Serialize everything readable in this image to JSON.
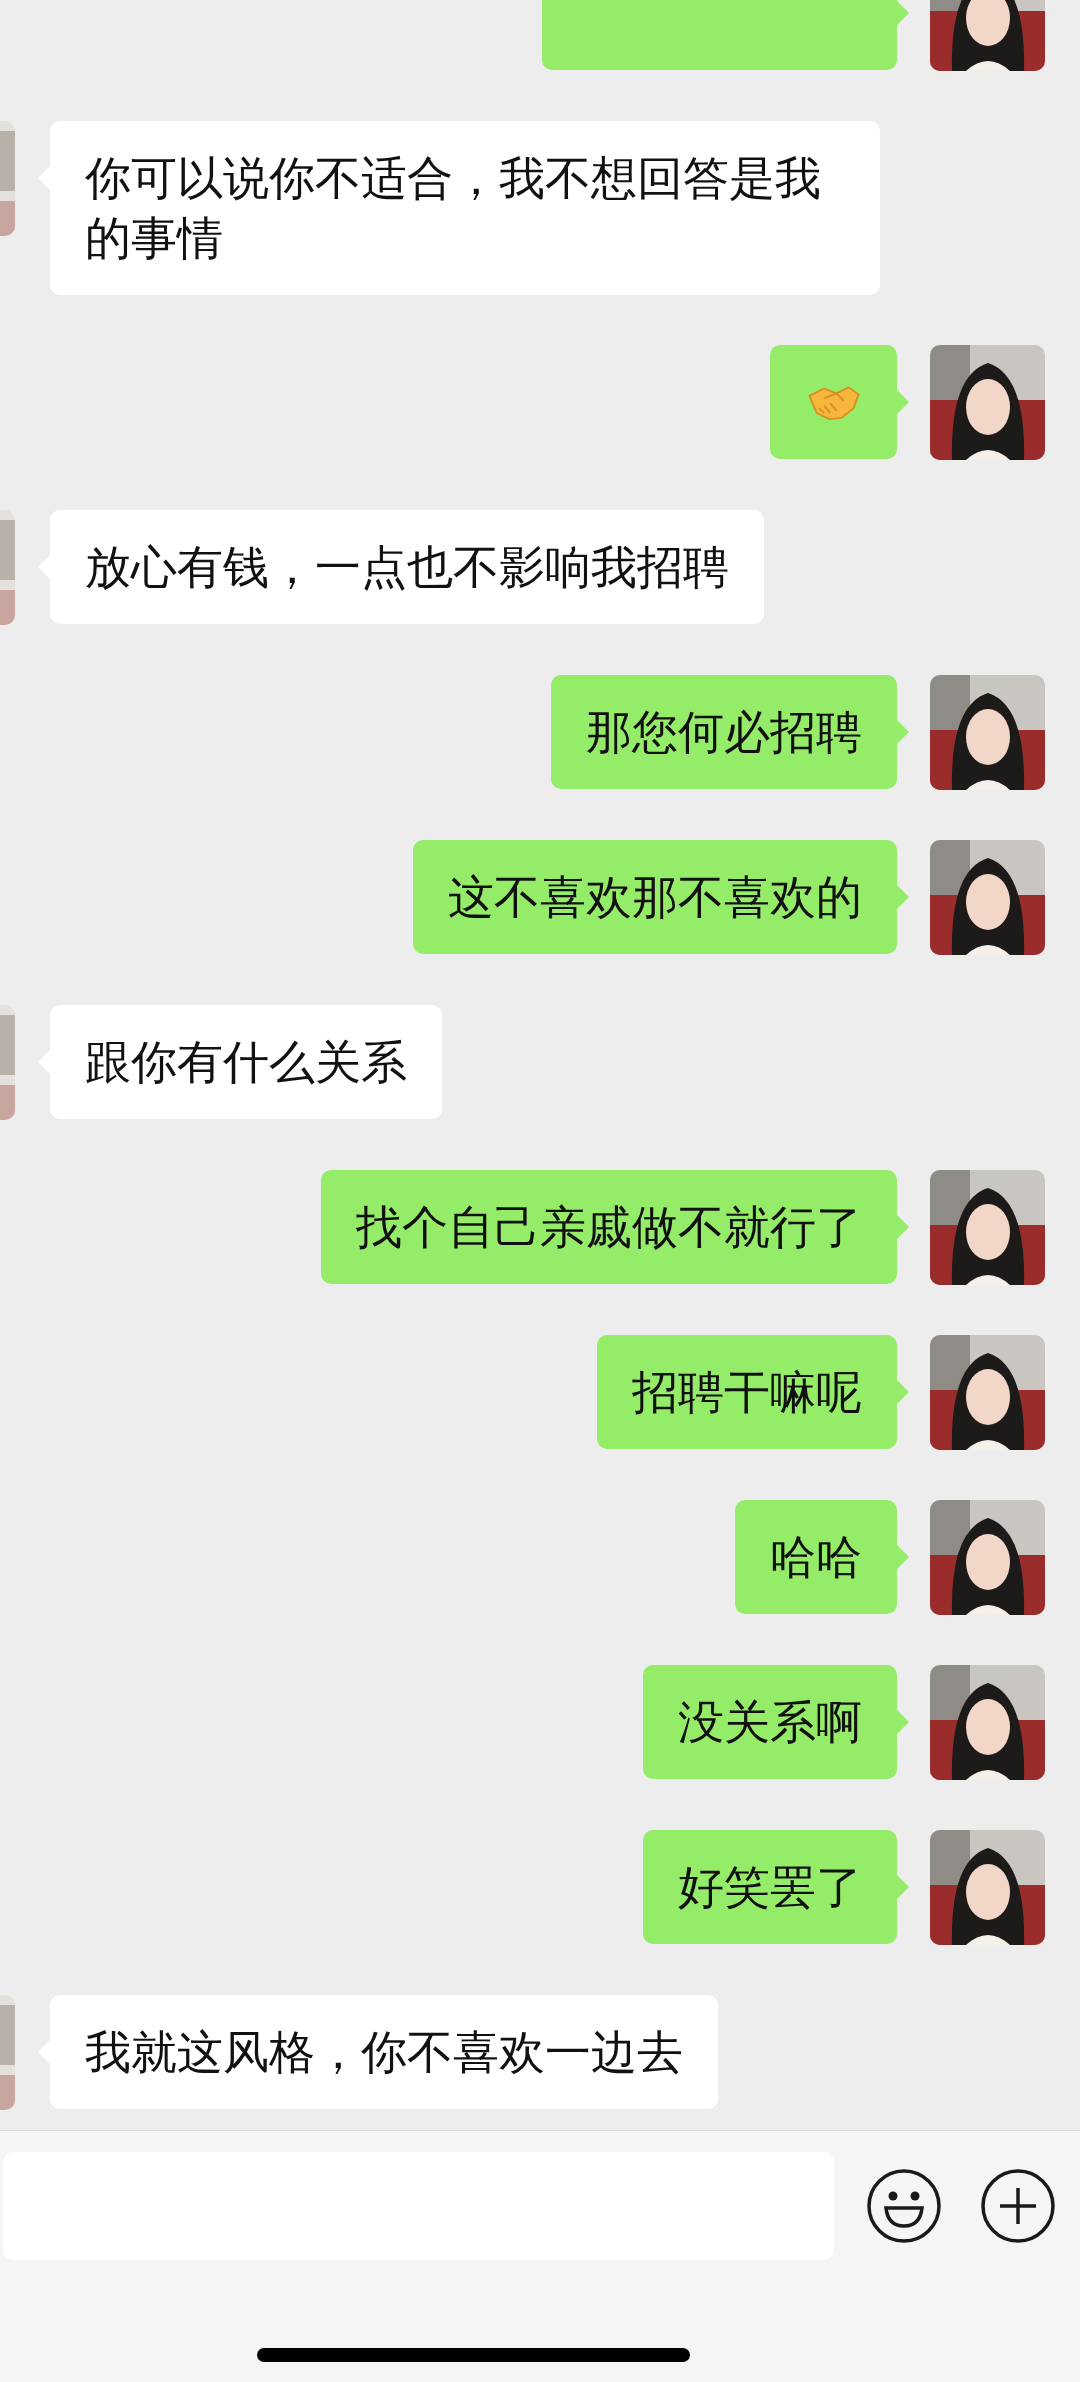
{
  "messages": [
    {
      "sent": true,
      "kind": "cut"
    },
    {
      "sent": false,
      "kind": "text",
      "text": "你可以说你不适合，我不想回答是我的事情"
    },
    {
      "sent": true,
      "kind": "sticker"
    },
    {
      "sent": false,
      "kind": "text",
      "text": "放心有钱，一点也不影响我招聘"
    },
    {
      "sent": true,
      "kind": "text",
      "text": "那您何必招聘"
    },
    {
      "sent": true,
      "kind": "text",
      "text": "这不喜欢那不喜欢的"
    },
    {
      "sent": false,
      "kind": "text",
      "text": "跟你有什么关系"
    },
    {
      "sent": true,
      "kind": "text",
      "text": "找个自己亲戚做不就行了"
    },
    {
      "sent": true,
      "kind": "text",
      "text": "招聘干嘛呢"
    },
    {
      "sent": true,
      "kind": "text",
      "text": "哈哈"
    },
    {
      "sent": true,
      "kind": "text",
      "text": "没关系啊"
    },
    {
      "sent": true,
      "kind": "text",
      "text": "好笑罢了"
    },
    {
      "sent": false,
      "kind": "text",
      "text": "我就这风格，你不喜欢一边去"
    }
  ]
}
